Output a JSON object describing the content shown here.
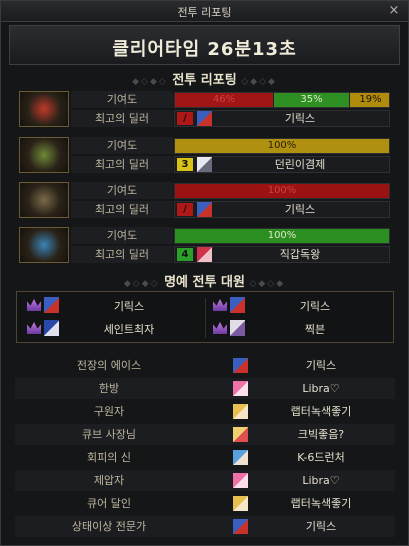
{
  "window": {
    "title": "전투 리포팅",
    "close_label": "×"
  },
  "header": {
    "title": "클리어타임 26분13초"
  },
  "report": {
    "section_title": "전투 리포팅",
    "contrib_label": "기여도",
    "dealer_label": "최고의 딜러",
    "players": [
      {
        "portrait_icon": "fire-helmet-portrait",
        "accent": "#c03a2a",
        "segments": [
          {
            "label": "46%",
            "value": 46,
            "color": "#a01515",
            "text_color": "#d04040"
          },
          {
            "label": "35%",
            "value": 35,
            "color": "#2e8f22",
            "text_color": "#dfe8c8"
          },
          {
            "label": "19%",
            "value": 19,
            "color": "#b08b0c",
            "text_color": "#1a1400"
          }
        ],
        "dealer": {
          "badge": "/",
          "badge_color": "#b01818",
          "icon": "blue-knight-icon",
          "name": "기릭스"
        }
      },
      {
        "portrait_icon": "green-thorn-helmet-portrait",
        "accent": "#6f8a38",
        "segments": [
          {
            "label": "100%",
            "value": 100,
            "color": "#b09010",
            "text_color": "#2a2000"
          }
        ],
        "dealer": {
          "badge": "3",
          "badge_color": "#d8c218",
          "icon": "white-fox-icon",
          "name": "던린이겸제"
        }
      },
      {
        "portrait_icon": "dark-horned-helmet-portrait",
        "accent": "#7a6a4a",
        "segments": [
          {
            "label": "100%",
            "value": 100,
            "color": "#9a1212",
            "text_color": "#d04040"
          }
        ],
        "dealer": {
          "badge": "/",
          "badge_color": "#b01818",
          "icon": "blue-knight-icon",
          "name": "기릭스"
        }
      },
      {
        "portrait_icon": "ice-crown-helmet-portrait",
        "accent": "#3a84b8",
        "segments": [
          {
            "label": "100%",
            "value": 100,
            "color": "#2a8e20",
            "text_color": "#dfe8c8"
          }
        ],
        "dealer": {
          "badge": "4",
          "badge_color": "#2aa02a",
          "icon": "red-mage-icon",
          "name": "직갑독왕"
        }
      }
    ]
  },
  "honor": {
    "section_title": "명예 전투 대원",
    "members": [
      {
        "icon": "blue-knight-icon",
        "name": "기릭스"
      },
      {
        "icon": "blue-knight-icon",
        "name": "기릭스"
      },
      {
        "icon": "blue-swordsman-icon",
        "name": "세인트최자"
      },
      {
        "icon": "white-hair-icon",
        "name": "찍븐"
      }
    ]
  },
  "awards": [
    {
      "title": "전장의 에이스",
      "icon": "blue-knight-icon",
      "name": "기릭스"
    },
    {
      "title": "한방",
      "icon": "pink-girl-icon",
      "name": "Libra♡"
    },
    {
      "title": "구원자",
      "icon": "blonde-girl-icon",
      "name": "랩터녹색좋기"
    },
    {
      "title": "큐브 사장님",
      "icon": "blonde-fighter-icon",
      "name": "크빅좋음?"
    },
    {
      "title": "회피의 신",
      "icon": "blue-hair-icon",
      "name": "K-6드런처"
    },
    {
      "title": "제압자",
      "icon": "pink-girl-icon",
      "name": "Libra♡"
    },
    {
      "title": "큐어 달인",
      "icon": "blonde-girl-icon",
      "name": "랩터녹색좋기"
    },
    {
      "title": "상태이상 전문가",
      "icon": "blue-knight-icon",
      "name": "기릭스"
    }
  ]
}
